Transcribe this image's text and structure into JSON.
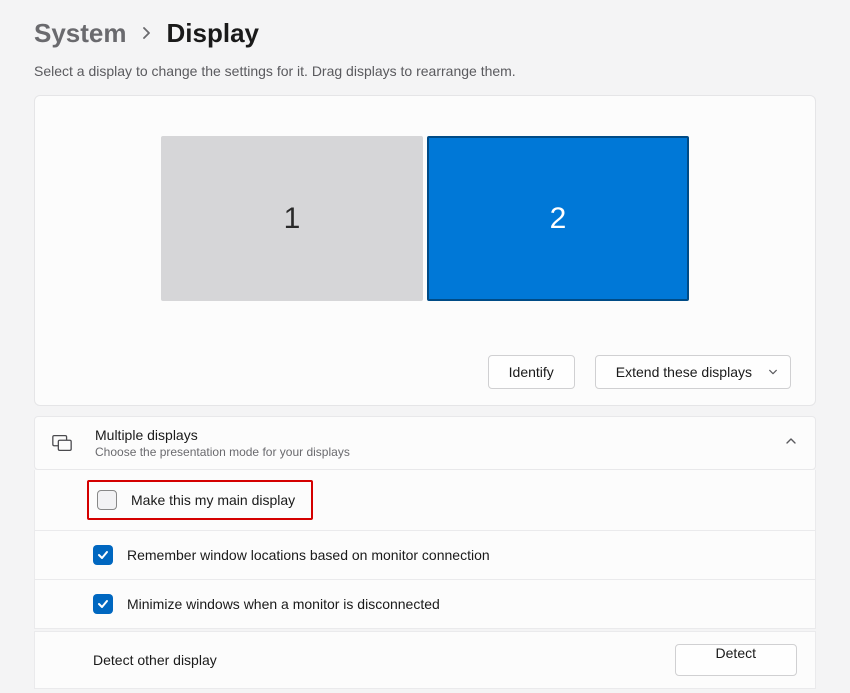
{
  "breadcrumb": {
    "parent": "System",
    "current": "Display"
  },
  "subtitle": "Select a display to change the settings for it. Drag displays to rearrange them.",
  "monitors": {
    "items": [
      {
        "label": "1",
        "selected": false
      },
      {
        "label": "2",
        "selected": true
      }
    ]
  },
  "actions": {
    "identify": "Identify",
    "mode_dropdown": "Extend these displays"
  },
  "multiple_displays": {
    "title": "Multiple displays",
    "description": "Choose the presentation mode for your displays",
    "options": {
      "main_display": {
        "label": "Make this my main display",
        "checked": false
      },
      "remember_locations": {
        "label": "Remember window locations based on monitor connection",
        "checked": true
      },
      "minimize_on_disconnect": {
        "label": "Minimize windows when a monitor is disconnected",
        "checked": true
      }
    },
    "detect": {
      "label": "Detect other display",
      "button": "Detect"
    }
  },
  "colors": {
    "accent": "#0078d7",
    "highlight_border": "#d40000"
  }
}
